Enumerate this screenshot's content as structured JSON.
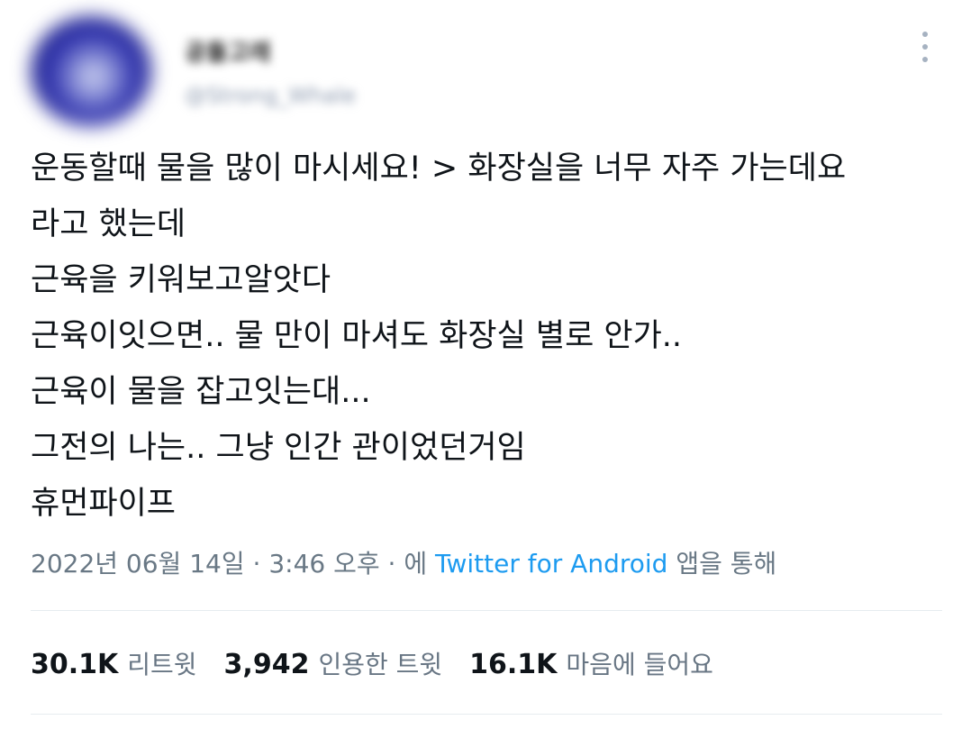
{
  "author": {
    "display_name": "공돌고래",
    "handle": "@Strong_Whale"
  },
  "tweet": {
    "lines": [
      "운동할때 물을 많이 마시세요! > 화장실을 너무 자주 가는데요",
      "라고 했는데",
      "근육을 키워보고알앗다",
      "근육이잇으면.. 물 만이 마셔도 화장실 별로 안가..",
      "근육이 물을 잡고잇는대...",
      "그전의 나는.. 그냥 인간 관이었던거임",
      "휴먼파이프"
    ],
    "date": "2022년 06월 14일",
    "separator_1": "·",
    "time": "3:46 오후",
    "separator_2": "·",
    "via_prefix": "에",
    "source_app": "Twitter for Android",
    "via_suffix": "앱을 통해"
  },
  "stats": {
    "retweets": {
      "count": "30.1K",
      "label": "리트윗"
    },
    "quotes": {
      "count": "3,942",
      "label": "인용한 트윗"
    },
    "likes": {
      "count": "16.1K",
      "label": "마음에 들어요"
    }
  },
  "icons": {
    "more": "more-vertical-icon"
  },
  "colors": {
    "link": "#1d9bf0",
    "text": "#0f1419",
    "secondary": "#697885",
    "divider": "#e6ecf0"
  }
}
